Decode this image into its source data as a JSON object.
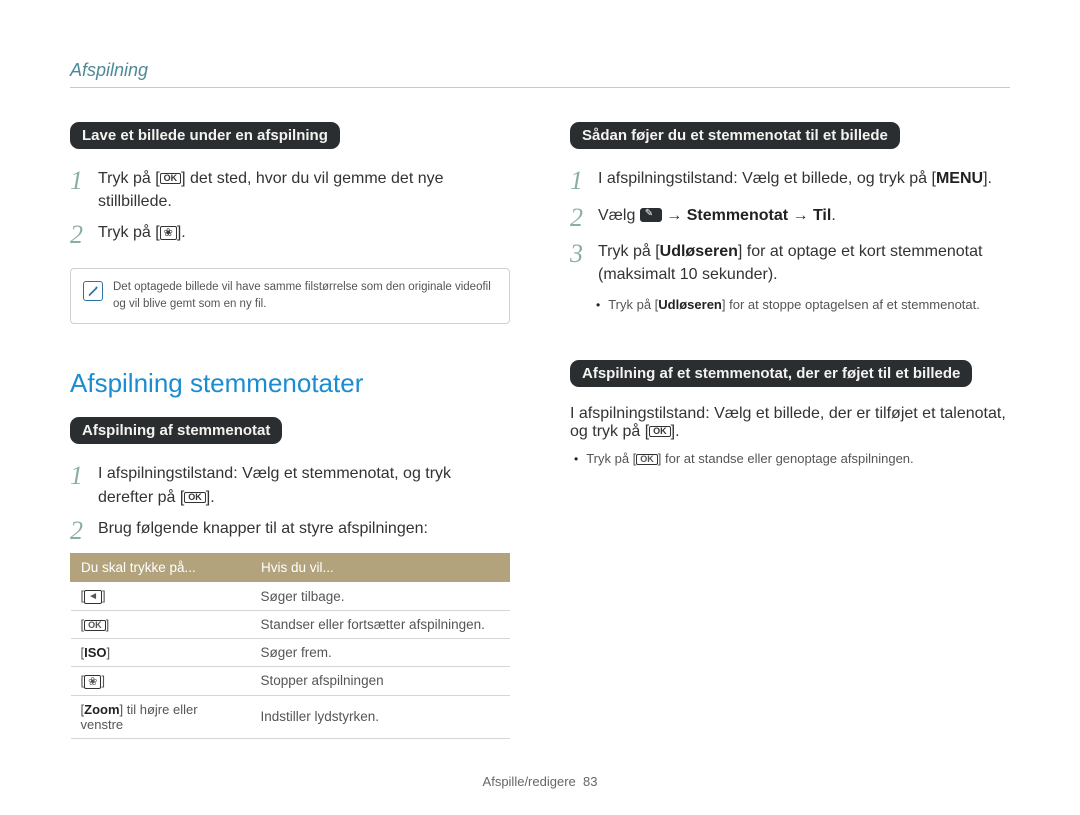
{
  "header": {
    "running": "Afspilning"
  },
  "left": {
    "pill1": "Lave et billede under en afspilning",
    "step1_pre": "Tryk på [",
    "step1_post": "] det sted, hvor du vil gemme det nye stillbillede.",
    "step2_pre": "Tryk på [",
    "step2_post": "].",
    "note": "Det optagede billede vil have samme filstørrelse som den originale videofil og vil blive gemt som en ny fil.",
    "section_title": "Afspilning stemmenotater",
    "pill2": "Afspilning af stemmenotat",
    "p2_step1_pre": "I afspilningstilstand: Vælg et stemmenotat, og tryk derefter på [",
    "p2_step1_post": "].",
    "p2_step2": "Brug følgende knapper til at styre afspilningen:",
    "table": {
      "headers": [
        "Du skal trykke på...",
        "Hvis du vil..."
      ],
      "rows": [
        {
          "key": "left-icon",
          "key_label": "",
          "desc": "Søger tilbage."
        },
        {
          "key": "ok-icon",
          "key_label": "",
          "desc": "Standser eller fortsætter afspilningen."
        },
        {
          "key": "iso",
          "key_label": "ISO",
          "desc": "Søger frem."
        },
        {
          "key": "flower-icon",
          "key_label": "",
          "desc": "Stopper afspilningen"
        },
        {
          "key": "zoom",
          "key_label": "Zoom",
          "key_suffix": " til højre eller venstre",
          "desc": "Indstiller lydstyrken."
        }
      ]
    }
  },
  "right": {
    "pill1": "Sådan føjer du et stemmenotat til et billede",
    "r1_step1_pre": "I afspilningstilstand: Vælg et billede, og tryk på [",
    "r1_step1_label": "MENU",
    "r1_step1_post": "].",
    "r1_step2_pre": "Vælg ",
    "r1_step2_mid1": " → ",
    "r1_step2_bold1": "Stemmenotat",
    "r1_step2_mid2": " → ",
    "r1_step2_bold2": "Til",
    "r1_step2_post": ".",
    "r1_step3_pre": "Tryk på [",
    "r1_step3_bold": "Udløseren",
    "r1_step3_post": "] for at optage et kort stemmenotat (maksimalt 10 sekunder).",
    "r1_bullet_pre": "Tryk på [",
    "r1_bullet_bold": "Udløseren",
    "r1_bullet_post": "] for at stoppe optagelsen af et stemmenotat.",
    "pill2": "Afspilning af et stemmenotat, der er føjet til et billede",
    "r2_body_pre": "I afspilningstilstand: Vælg et billede, der er tilføjet et talenotat, og tryk på [",
    "r2_body_post": "].",
    "r2_bullet_pre": "Tryk på [",
    "r2_bullet_post": "] for at standse eller genoptage afspilningen."
  },
  "icons": {
    "ok": "OK",
    "left": "◄",
    "iso": "ISO",
    "flower": "❀",
    "menu": "MENU"
  },
  "footer": {
    "label": "Afspille/redigere",
    "page": "83"
  }
}
